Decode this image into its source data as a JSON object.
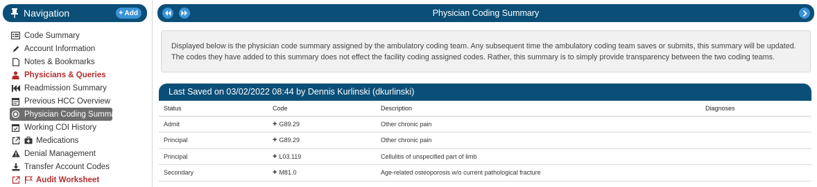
{
  "sidebar": {
    "title": "Navigation",
    "add_label": "Add",
    "items": [
      {
        "label": "Code Summary",
        "icon": "list-card-icon"
      },
      {
        "label": "Account Information",
        "icon": "pencil-icon"
      },
      {
        "label": "Notes & Bookmarks",
        "icon": "document-icon"
      },
      {
        "label": "Physicians & Queries",
        "icon": "user-md-icon"
      },
      {
        "label": "Readmission Summary",
        "icon": "fast-backward-icon"
      },
      {
        "label": "Previous HCC Overview",
        "icon": "calendar-icon"
      },
      {
        "label": "Physician Coding Summary",
        "icon": "record-icon"
      },
      {
        "label": "Working CDI History",
        "icon": "calendar-check-icon"
      },
      {
        "label": "Medications",
        "icon": "medkit-icon"
      },
      {
        "label": "Denial Management",
        "icon": "warning-icon"
      },
      {
        "label": "Transfer Account Codes",
        "icon": "download-icon"
      },
      {
        "label": "Audit Worksheet",
        "icon": "flag-icon"
      }
    ]
  },
  "header": {
    "title": "Physician Coding Summary"
  },
  "info": {
    "text": "Displayed below is the physician code summary assigned by the ambulatory coding team. Any subsequent time the ambulatory coding team saves or submits, this summary will be updated. The codes they have added to this summary does not effect the facility coding assigned codes. Rather, this summary is to simply provide transparency between the two coding teams."
  },
  "summary": {
    "title": "Last Saved on 03/02/2022 08:44 by Dennis Kurlinski (dkurlinski)",
    "columns": [
      "Status",
      "Code",
      "Description",
      "Diagnoses"
    ],
    "rows": [
      {
        "status": "Admit",
        "code": "G89.29",
        "description": "Other chronic pain",
        "diagnoses": ""
      },
      {
        "status": "Principal",
        "code": "G89.29",
        "description": "Other chronic pain",
        "diagnoses": ""
      },
      {
        "status": "Principal",
        "code": "L03.119",
        "description": "Cellulitis of unspecified part of limb",
        "diagnoses": ""
      },
      {
        "status": "Secondary",
        "code": "M81.0",
        "description": "Age-related osteoporosis w/o current pathological fracture",
        "diagnoses": ""
      }
    ]
  },
  "colors": {
    "header_bg": "#0b4f78",
    "accent_blue": "#3a93d6",
    "highlight_red": "#b32d2e",
    "active_bg": "#6d6d6d"
  }
}
